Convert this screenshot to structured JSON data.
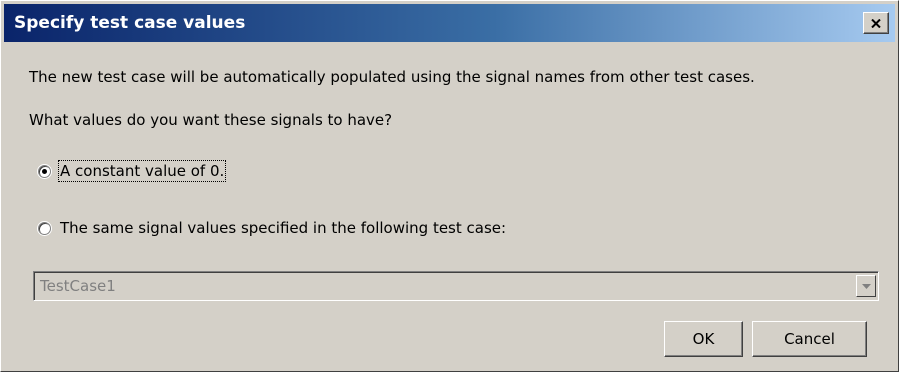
{
  "window": {
    "title": "Specify test case values",
    "close_icon": "close-icon"
  },
  "content": {
    "description": "The new test case will be automatically populated using the signal names from other test cases.",
    "question": "What values do you want these signals to have?"
  },
  "options": [
    {
      "label": "A constant value of 0.",
      "selected": true
    },
    {
      "label": "The same signal values specified in the following test case:",
      "selected": false
    }
  ],
  "test_case_select": {
    "value": "TestCase1",
    "disabled": true,
    "arrow_icon": "chevron-down-icon"
  },
  "buttons": {
    "ok_label": "OK",
    "cancel_label": "Cancel"
  },
  "colors": {
    "titlebar_start": "#0a246a",
    "titlebar_end": "#a6caf0",
    "dialog_background": "#d4d0c8",
    "disabled_text": "#808080"
  }
}
